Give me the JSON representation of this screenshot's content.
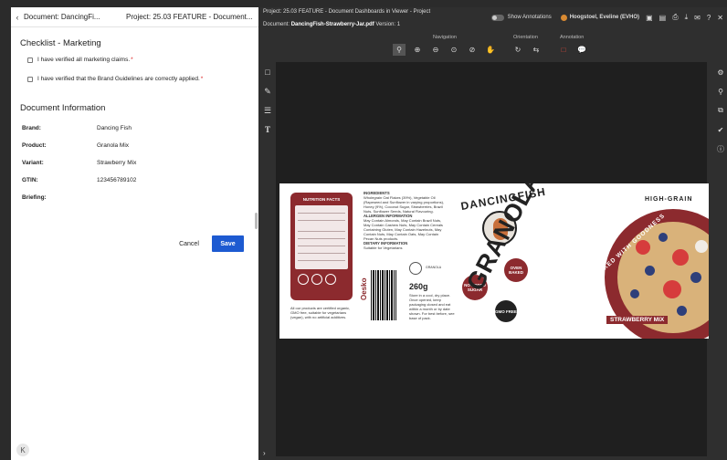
{
  "left_panel": {
    "breadcrumb_document": "Document: DancingFi...",
    "breadcrumb_project": "Project: 25.03 FEATURE - Document...",
    "checklist_title": "Checklist - Marketing",
    "checklist_items": [
      {
        "label": "I have verified all marketing claims.",
        "required": "*"
      },
      {
        "label": "I have verified that the Brand Guidelines are correctly applied.",
        "required": "*"
      }
    ],
    "doc_info_title": "Document Information",
    "info_rows": [
      {
        "key": "Brand:",
        "value": "Dancing Fish"
      },
      {
        "key": "Product:",
        "value": "Granola Mix"
      },
      {
        "key": "Variant:",
        "value": "Strawberry Mix"
      },
      {
        "key": "GTIN:",
        "value": "123456789102"
      },
      {
        "key": "Briefing:",
        "value": ""
      }
    ],
    "cancel_label": "Cancel",
    "save_label": "Save",
    "collapse_glyph": "K"
  },
  "viewer": {
    "project_line": "Project: 25.03 FEATURE - Document Dashboards in Viewer - Project",
    "document_prefix": "Document:",
    "document_name": "DancingFish-Strawberry-Jar.pdf",
    "version": "Version: 1",
    "show_annotations": "Show Annotations",
    "user_name": "Hoogstoel, Eveline (EVHO)",
    "toolbar_groups": {
      "navigation": "Navigation",
      "orientation": "Orientation",
      "annotation": "Annotation"
    }
  },
  "artwork": {
    "nutrition_title": "NUTRITION FACTS",
    "ingredients_title": "INGREDIENTS",
    "ingredients_text": "Wholegrain Oat Flakes (39%), Vegetable Oil (Rapeseed and Sunflower in varying proportions), Honey (9%), Coconut Sugar, Strawberries, Brazil Nuts, Sunflower Seeds, Natural Flavouring.",
    "allergen_title": "ALLERGEN INFORMATION",
    "allergen_text": "May Contain Almonds, May Contain Brazil Nuts, May Contain Cashew Nuts, May Contain Cereals Containing Gluten, May Contain Hazelnuts, May Contain Nuts, May Contain Oats, May Contain Pecan Nuts products.",
    "dietary_title": "DIETARY INFORMATION",
    "dietary_text": "Suitable for Vegetarians",
    "organic_note": "All our products are certified organic, GMO free, suitable for vegetarians (vegan), with no artificial additives.",
    "small_logo_text": "GRANOLA",
    "oesko": "Oesko",
    "weight": "260g",
    "storage_text": "Store in a cool, dry place. Once opened, keep packaging closed and eat within a month or by date shown. For best before, see base of pack.",
    "brand_arc": "DANCINGFISH",
    "badge_1": "NO ADDED SUGAR",
    "badge_2": "OVEN BAKED",
    "badge_3": "GMO FREE",
    "product_name": "GRANOLA MIX",
    "high_grain": "HIGH-GRAIN",
    "packed_with": "PACKED WITH GOODNESS",
    "variant_banner": "STRAWBERRY MIX"
  },
  "colors": {
    "save_blue": "#1d5ad1",
    "brand_red": "#8c2a2e",
    "required_red": "#dd2222"
  }
}
